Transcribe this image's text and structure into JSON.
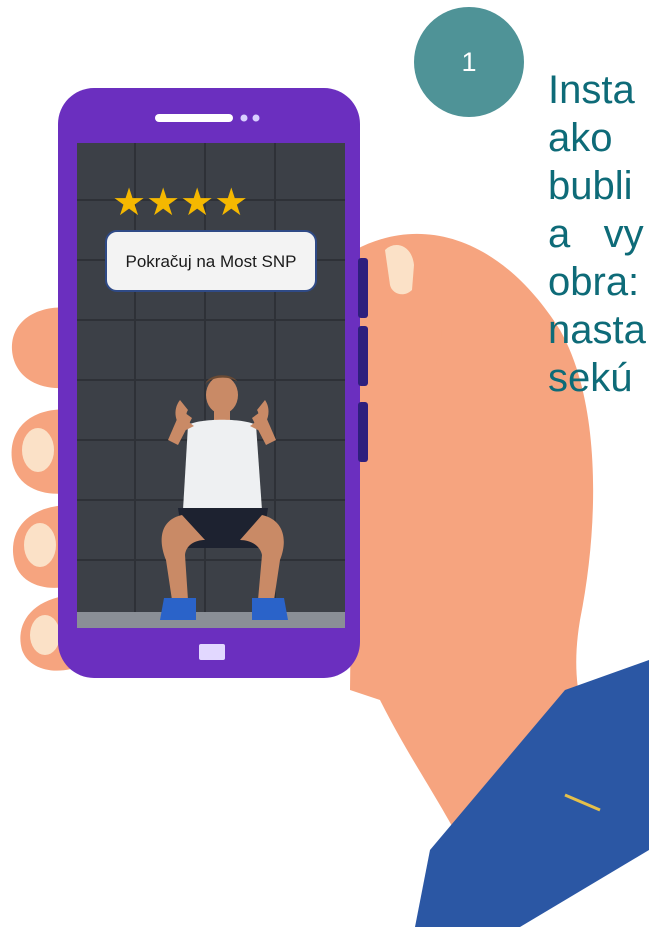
{
  "step": {
    "number": "1"
  },
  "instruction": {
    "lines": [
      "Insta",
      "ako",
      "bubli",
      "a   vy",
      "obra:",
      "nasta",
      "sekú"
    ]
  },
  "phone_screen": {
    "rating": {
      "stars_filled": 4,
      "stars_total": 4,
      "display": "★★★★"
    },
    "bubble_text": "Pokračuj na Most SNP"
  },
  "colors": {
    "phone_body": "#6b2fbf",
    "badge": "#4f9397",
    "instruction_text": "#0e6b78",
    "star": "#f5b800",
    "skin": "#f6a47f",
    "sleeve": "#2b57a4"
  }
}
